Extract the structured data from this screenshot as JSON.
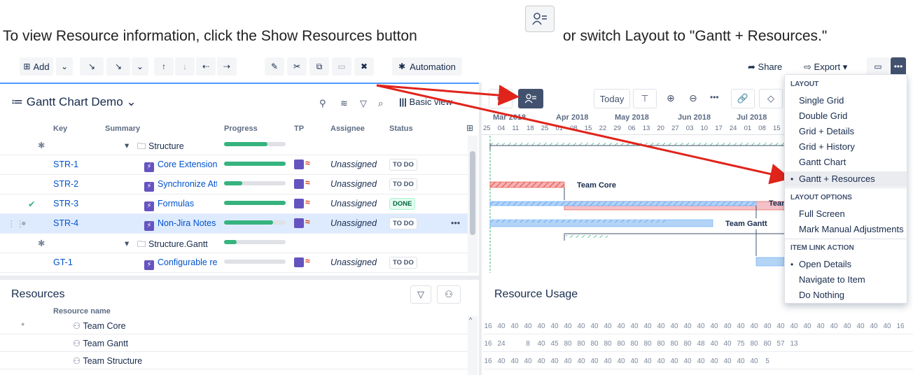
{
  "caption": {
    "part1": "To view Resource information, click the Show Resources button",
    "part2": "or switch Layout to \"Gantt + Resources.\""
  },
  "toolbar": {
    "add": "Add",
    "automation": "Automation",
    "share": "Share",
    "export": "Export"
  },
  "grid": {
    "title": "Gantt Chart Demo",
    "view": "Basic view",
    "columns": [
      "Key",
      "Summary",
      "Progress",
      "TP",
      "Assignee",
      "Status"
    ],
    "rows": [
      {
        "key": "",
        "summary": "Structure",
        "progress": 0.7,
        "assignee": "",
        "status": "",
        "type": "folder"
      },
      {
        "key": "STR-1",
        "summary": "Core Extensions",
        "progress": 1.0,
        "assignee": "Unassigned",
        "status": "TO DO",
        "type": "issue"
      },
      {
        "key": "STR-2",
        "summary": "Synchronize Att",
        "progress": 0.3,
        "assignee": "Unassigned",
        "status": "TO DO",
        "type": "issue"
      },
      {
        "key": "STR-3",
        "summary": "Formulas",
        "progress": 1.0,
        "assignee": "Unassigned",
        "status": "DONE",
        "type": "issue"
      },
      {
        "key": "STR-4",
        "summary": "Non-Jira Notes",
        "progress": 0.8,
        "assignee": "Unassigned",
        "status": "TO DO",
        "type": "issue"
      },
      {
        "key": "",
        "summary": "Structure.Gantt",
        "progress": 0.2,
        "assignee": "",
        "status": "",
        "type": "folder"
      },
      {
        "key": "GT-1",
        "summary": "Configurable re",
        "progress": 0.0,
        "assignee": "Unassigned",
        "status": "TO DO",
        "type": "issue"
      }
    ]
  },
  "gantt": {
    "today": "Today",
    "months": [
      "Mar 2018",
      "Apr 2018",
      "May 2018",
      "Jun 2018",
      "Jul 2018"
    ],
    "days": [
      "25",
      "04",
      "11",
      "18",
      "25",
      "01",
      "08",
      "15",
      "22",
      "29",
      "06",
      "13",
      "20",
      "27",
      "03",
      "10",
      "17",
      "24",
      "01",
      "08",
      "15"
    ],
    "bar_labels": [
      "Team Core",
      "Team",
      "Team Gantt"
    ]
  },
  "menu": {
    "layout_header": "LAYOUT",
    "layout_items": [
      "Single Grid",
      "Double Grid",
      "Grid + Details",
      "Grid + History",
      "Gantt Chart",
      "Gantt + Resources"
    ],
    "layout_selected": "Gantt + Resources",
    "options_header": "LAYOUT OPTIONS",
    "options_items": [
      "Full Screen",
      "Mark Manual Adjustments"
    ],
    "link_header": "ITEM LINK ACTION",
    "link_items": [
      "Open Details",
      "Navigate to Item",
      "Do Nothing"
    ],
    "link_selected": "Open Details"
  },
  "resources": {
    "title": "Resources",
    "column": "Resource name",
    "rows": [
      "Team Core",
      "Team Gantt",
      "Team Structure"
    ]
  },
  "usage": {
    "title": "Resource Usage",
    "rows": [
      [
        "16",
        "40",
        "40",
        "40",
        "40",
        "40",
        "40",
        "40",
        "40",
        "40",
        "40",
        "40",
        "40",
        "40",
        "40",
        "40",
        "40",
        "40",
        "40",
        "40",
        "40",
        "40",
        "40",
        "40",
        "40",
        "40",
        "40",
        "40",
        "40",
        "40",
        "40",
        "16"
      ],
      [
        "16",
        "24",
        "",
        "8",
        "40",
        "45",
        "80",
        "80",
        "80",
        "80",
        "80",
        "80",
        "80",
        "80",
        "80",
        "80",
        "48",
        "40",
        "40",
        "75",
        "80",
        "80",
        "57",
        "13"
      ],
      [
        "16",
        "40",
        "40",
        "40",
        "40",
        "40",
        "40",
        "40",
        "40",
        "40",
        "40",
        "40",
        "40",
        "40",
        "40",
        "40",
        "40",
        "40",
        "40",
        "40",
        "40",
        "5"
      ]
    ]
  },
  "colors": {
    "accent": "#0052cc",
    "arrow": "#e0241b",
    "done": "#36b37e",
    "bar_red": "#f5b0b8",
    "bar_blue": "#b3d4f5"
  }
}
